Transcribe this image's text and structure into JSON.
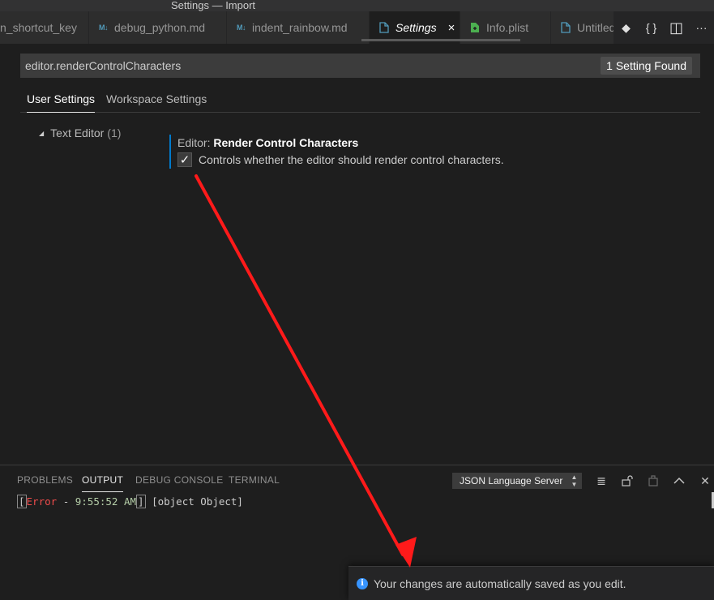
{
  "window": {
    "title": "Settings — Import"
  },
  "tabs": [
    {
      "label": "n_shortcut_key",
      "icon": "file-icon"
    },
    {
      "label": "debug_python.md",
      "icon": "markdown-icon"
    },
    {
      "label": "indent_rainbow.md",
      "icon": "markdown-icon"
    },
    {
      "label": "Settings",
      "icon": "file-icon",
      "close": "×"
    },
    {
      "label": "Info.plist",
      "icon": "plist-file-icon"
    },
    {
      "label": "Untitled",
      "icon": "file-icon"
    }
  ],
  "markdown_badge": "M↓",
  "editor_actions": [
    {
      "icon": "git-compare-icon",
      "glyph": "◆"
    },
    {
      "icon": "json-braces-icon",
      "glyph": "{ }"
    },
    {
      "icon": "split-editor-icon",
      "glyph": "◫"
    },
    {
      "icon": "more-actions-icon",
      "glyph": "···"
    }
  ],
  "search": {
    "value": "editor.renderControlCharacters",
    "result_count": "1 Setting Found"
  },
  "settings_tabs": [
    "User Settings",
    "Workspace Settings"
  ],
  "tree": {
    "label": "Text Editor",
    "count": "(1)",
    "caret": "◢"
  },
  "setting": {
    "category": "Editor:",
    "name": "Render Control Characters",
    "checked": true,
    "check_glyph": "✓",
    "description": "Controls whether the editor should render control characters."
  },
  "panel": {
    "tabs": [
      "PROBLEMS",
      "OUTPUT",
      "DEBUG CONSOLE",
      "TERMINAL"
    ],
    "active_tab": "OUTPUT",
    "channel": "JSON Language Server",
    "channel_arrows": "▲▼",
    "actions": [
      {
        "icon": "clear-output-icon",
        "glyph": "≣"
      },
      {
        "icon": "lock-scroll-icon",
        "glyph": "🔓"
      },
      {
        "icon": "open-log-icon",
        "glyph": "⎘"
      },
      {
        "icon": "maximize-panel-icon",
        "glyph": "︿"
      },
      {
        "icon": "close-panel-icon",
        "glyph": "✕"
      }
    ],
    "output": {
      "open_bracket": "[",
      "level": "Error",
      "separator": " - ",
      "time": "9:55:52 AM",
      "close_bracket": "]",
      "message": " [object Object]"
    }
  },
  "notification": {
    "icon": "info-icon",
    "icon_glyph": "i",
    "message": "Your changes are automatically saved as you edit."
  },
  "colors": {
    "accent": "#007acc",
    "annotation_arrow": "#ff1a1a",
    "error": "#f14c4c",
    "info": "#3794ff"
  }
}
